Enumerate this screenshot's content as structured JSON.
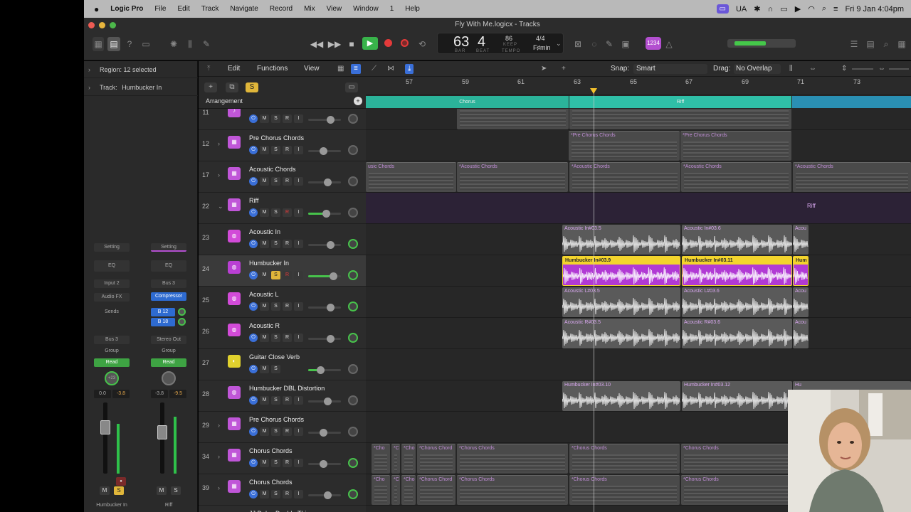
{
  "menubar": {
    "apple": "",
    "app": "Logic Pro",
    "items": [
      "File",
      "Edit",
      "Track",
      "Navigate",
      "Record",
      "Mix",
      "View",
      "Window",
      "1",
      "Help"
    ],
    "lang": "UA",
    "clock": "Fri 9 Jan  4:04pm"
  },
  "window": {
    "title": "Fly With Me.logicx - Tracks"
  },
  "lcd": {
    "bar": "63",
    "beat": "4",
    "bar_label": "BAR",
    "beat_label": "BEAT",
    "tempo": "86",
    "keep_label": "KEEP",
    "tempo_label": "TEMPO",
    "timesig": "4/4",
    "key": "F♯min"
  },
  "ctrl": {
    "badge": "1234"
  },
  "toolbar": {
    "edit": "Edit",
    "functions": "Functions",
    "view": "View",
    "snap_label": "Snap:",
    "snap_value": "Smart",
    "drag_label": "Drag:",
    "drag_value": "No Overlap"
  },
  "inspector": {
    "region_label": "Region:",
    "region_value": "12 selected",
    "track_label": "Track:",
    "track_value": "Humbucker In",
    "strip1": {
      "setting": "Setting",
      "eq": "EQ",
      "input": "Input 2",
      "fx": "Audio FX",
      "sends": "Sends",
      "out": "Bus 3",
      "group": "Group",
      "auto": "Read",
      "pan": "+23",
      "vol_a": "0.0",
      "vol_b": "-3.8",
      "name": "Humbucker In",
      "m": "M",
      "s": "S"
    },
    "strip2": {
      "setting": "Setting",
      "eq": "EQ",
      "input": "Bus 3",
      "fx": "Compressor",
      "send1": "B 12",
      "send2": "B 18",
      "out": "Stereo Out",
      "group": "Group",
      "auto": "Read",
      "vol_a": "-3.8",
      "vol_b": "-9.5",
      "name": "Riff",
      "m": "M",
      "s": "S"
    }
  },
  "header": {
    "label": "Arrangement",
    "s_btn": "S",
    "add": "+"
  },
  "ruler": {
    "bars": [
      "57",
      "59",
      "61",
      "63",
      "65",
      "67",
      "69",
      "71",
      "73"
    ]
  },
  "arrangement": [
    {
      "label": "Chorus"
    },
    {
      "label": "Riff"
    }
  ],
  "tracks": [
    {
      "num": "11",
      "name": "",
      "color": "#c056d8",
      "icon": "♪",
      "folder": false
    },
    {
      "num": "12",
      "name": "Pre Chorus Chords",
      "color": "#c056d8",
      "icon": "▦",
      "folder": true
    },
    {
      "num": "17",
      "name": "Acoustic Chords",
      "color": "#c056d8",
      "icon": "▦",
      "folder": true
    },
    {
      "num": "22",
      "name": "Riff",
      "color": "#c056d8",
      "icon": "▦",
      "folder": true
    },
    {
      "num": "23",
      "name": "Acoustic In",
      "color": "#d24bd8",
      "icon": "◍",
      "folder": false
    },
    {
      "num": "24",
      "name": "Humbucker In",
      "color": "#b93fd3",
      "icon": "◍",
      "folder": false
    },
    {
      "num": "25",
      "name": "Acoustic L",
      "color": "#d24bd8",
      "icon": "◍",
      "folder": false
    },
    {
      "num": "26",
      "name": "Acoustic R",
      "color": "#d24bd8",
      "icon": "◍",
      "folder": false
    },
    {
      "num": "27",
      "name": "Guitar Close Verb",
      "color": "#e0d12d",
      "icon": "◐",
      "folder": false
    },
    {
      "num": "28",
      "name": "Humbucker DBL Distortion",
      "color": "#c056d8",
      "icon": "◍",
      "folder": false
    },
    {
      "num": "29",
      "name": "Pre Chorus Chords",
      "color": "#c056d8",
      "icon": "▦",
      "folder": true
    },
    {
      "num": "34",
      "name": "Chorus Chords",
      "color": "#c056d8",
      "icon": "▦",
      "folder": true
    },
    {
      "num": "39",
      "name": "Chorus Chords",
      "color": "#c056d8",
      "icon": "▦",
      "folder": true
    },
    {
      "num": "",
      "name": "JJ Delay Double Thing",
      "color": "#c056d8",
      "icon": "",
      "folder": false
    }
  ],
  "regions": {
    "pre1": "*Pre Chorus Chords",
    "pre2": "*Pre Chorus Chords",
    "ac0": "usic Chords",
    "ac1": "*Acoustic Chords",
    "ac2": "*Acoustic Chords",
    "ac3": "*Acoustic Chords",
    "ac4": "*Acoustic Chords",
    "riff": "Riff",
    "ai1": "Acoustic In#03.5",
    "ai2": "Acoustic In#03.6",
    "ai3": "Acou",
    "hb1": "Humbucker In#03.9",
    "hb2": "Humbucker In#03.11",
    "hb3": "Hum",
    "al1": "Acoustic L#03.5",
    "al2": "Acoustic L#03.6",
    "al3": "Acou",
    "ar1": "Acoustic R#03.5",
    "ar2": "Acoustic R#03.6",
    "ar3": "Acou",
    "hd1": "Humbucker In#03.10",
    "hd2": "Humbucker In#03.12",
    "hd3": "Hu",
    "cc": [
      "*Cho",
      "*C",
      "*Cho",
      "*Chorus Chord",
      "*Chorus Chords",
      "*Chorus Chords",
      "*Chorus Chords"
    ],
    "cc2": [
      "*Cho",
      "*C",
      "*Cho",
      "*Chorus Chord",
      "*Chorus Chords",
      "*Chorus Chords",
      "*Chorus Chords"
    ]
  }
}
